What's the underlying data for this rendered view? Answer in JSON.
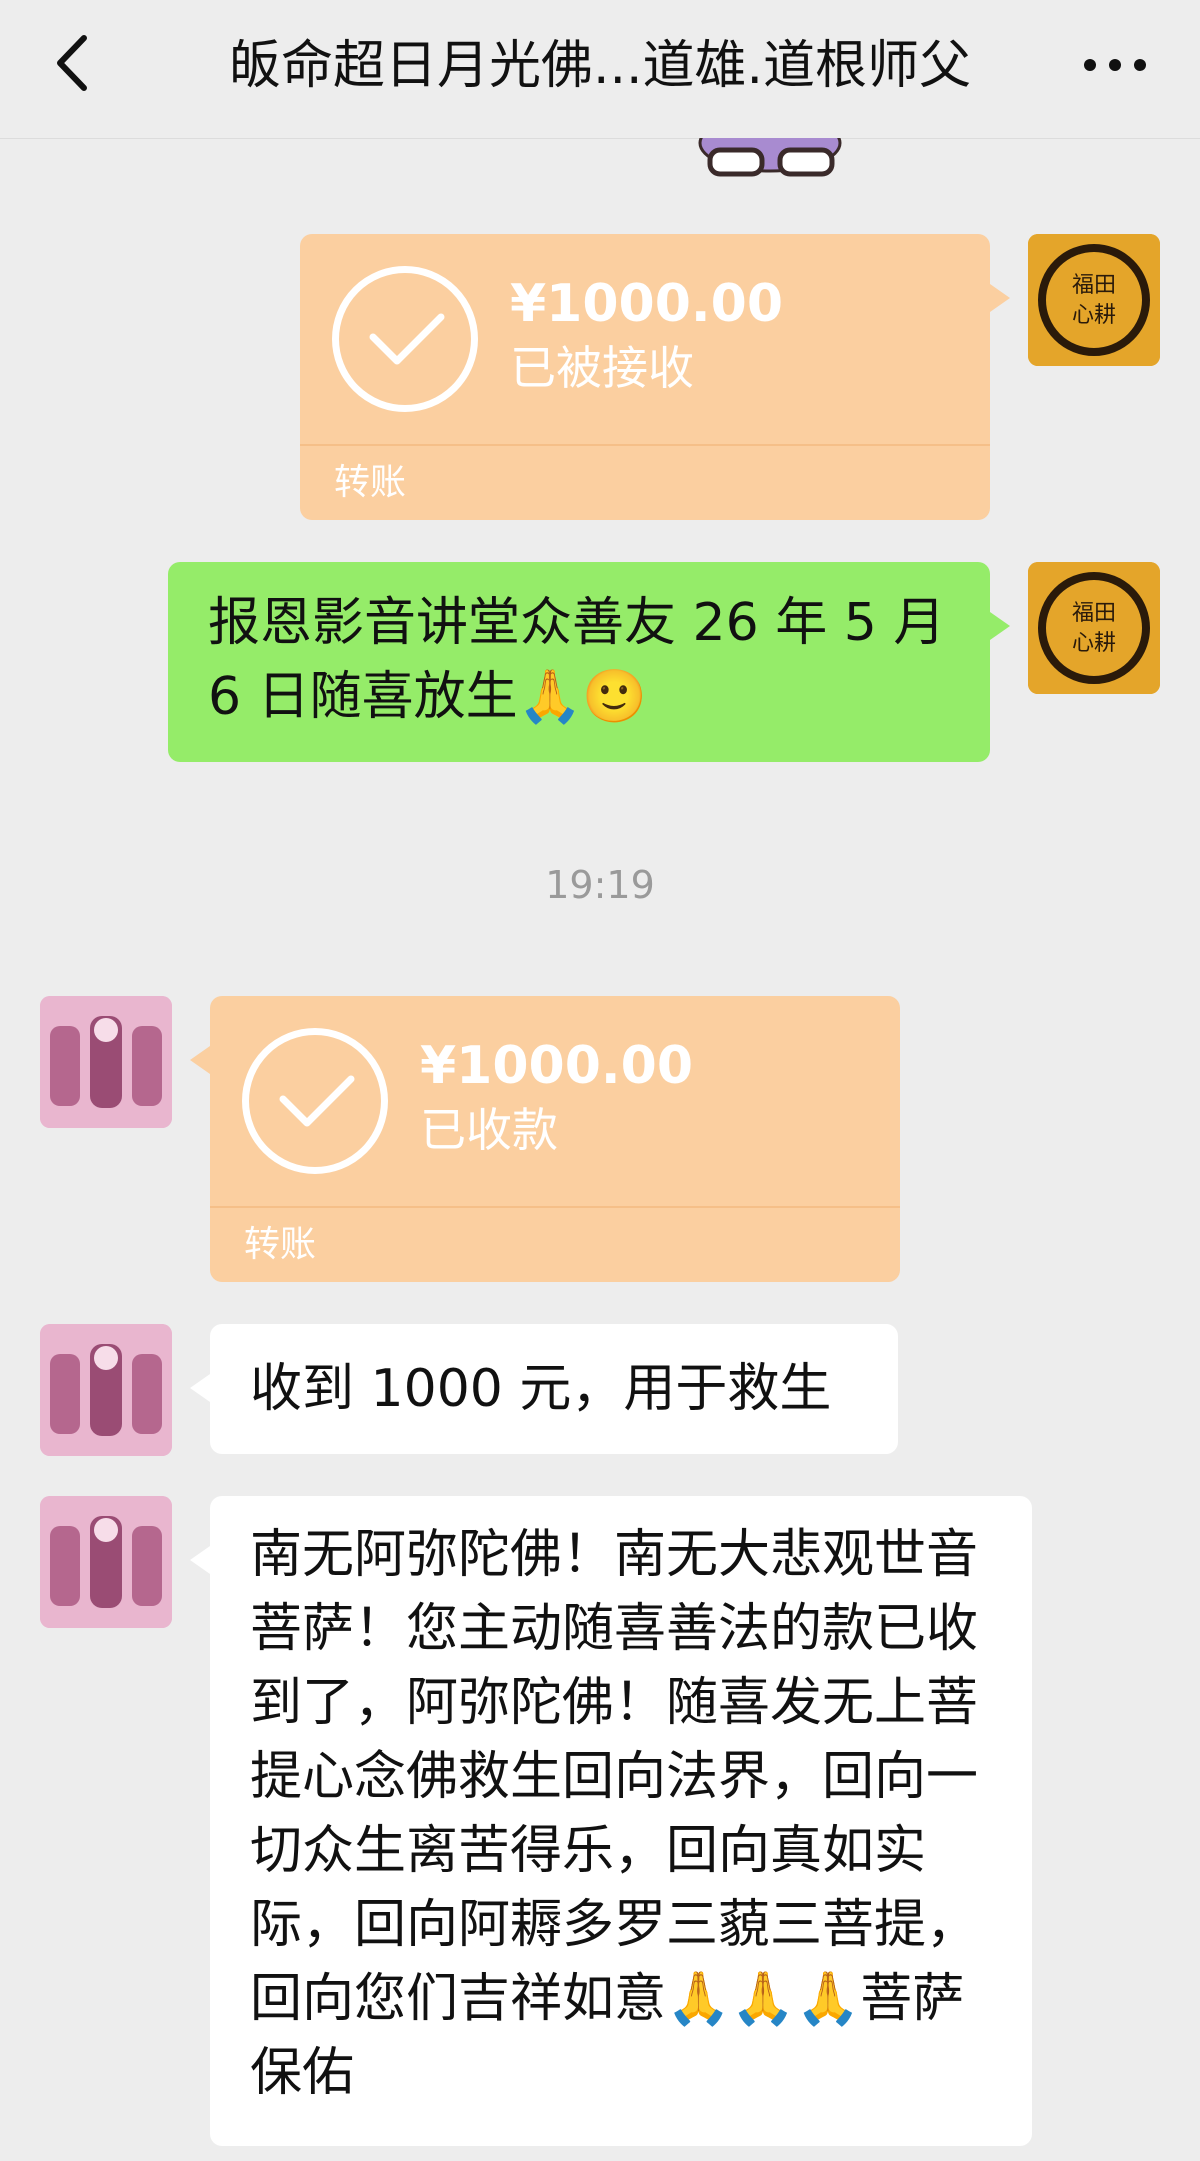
{
  "header": {
    "title": "皈命超日月光佛...道雄.道根师父"
  },
  "messages": [
    {
      "id": "m1",
      "side": "right",
      "type": "transfer",
      "amount": "¥1000.00",
      "status": "已被接收",
      "kind": "转账"
    },
    {
      "id": "m2",
      "side": "right",
      "type": "text",
      "text": "报恩影音讲堂众善友 26 年 5 月 6 日随喜放生🙏🙂"
    },
    {
      "id": "m3",
      "side": "left",
      "type": "transfer",
      "amount": "¥1000.00",
      "status": "已收款",
      "kind": "转账"
    },
    {
      "id": "m4",
      "side": "left",
      "type": "text",
      "text": "收到 1000 元，用于救生"
    },
    {
      "id": "m5",
      "side": "left",
      "type": "text",
      "text": "南无阿弥陀佛！南无大悲观世音菩萨！您主动随喜善法的款已收到了，阿弥陀佛！随喜发无上菩提心念佛救生回向法界，回向一切众生离苦得乐，回向真如实际，回向阿耨多罗三藐三菩提，回向您们吉祥如意🙏🙏🙏菩萨保佑"
    }
  ],
  "timestamp": "19:19",
  "avatars": {
    "me": {
      "text": "福田心耕",
      "color": "#e4a52a"
    },
    "other": {
      "color": "#e9b6cf"
    }
  },
  "icons": {
    "back": "chevron-left-icon",
    "more": "more-dots-icon",
    "check": "check-icon"
  }
}
